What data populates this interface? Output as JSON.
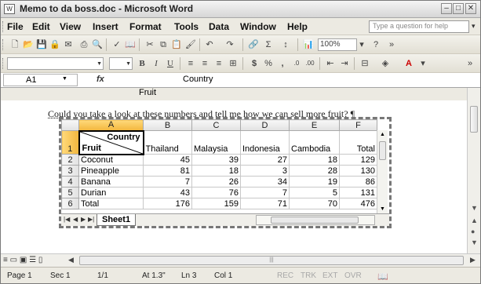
{
  "window": {
    "title": "Memo to da boss.doc - Microsoft Word"
  },
  "menu": {
    "items": [
      "File",
      "Edit",
      "View",
      "Insert",
      "Format",
      "Tools",
      "Data",
      "Window",
      "Help"
    ],
    "help_placeholder": "Type a question for help"
  },
  "toolbar": {
    "zoom": "100%",
    "bold": "B",
    "italic": "I",
    "underline": "U",
    "currency": "$",
    "percent": "%",
    "comma": ","
  },
  "formula_bar": {
    "cell_ref": "A1",
    "fx": "fx",
    "value_line1": "Country",
    "value_line2": "Fruit"
  },
  "document": {
    "text": "Could you take a look at these numbers and tell me how we can sell more fruit?"
  },
  "sheet": {
    "columns": [
      "A",
      "B",
      "C",
      "D",
      "E",
      "F"
    ],
    "header_cell": {
      "top": "Country",
      "bottom": "Fruit"
    },
    "header_row": [
      "Thailand",
      "Malaysia",
      "Indonesia",
      "Cambodia",
      "Total"
    ],
    "rows": [
      {
        "n": "2",
        "label": "Coconut",
        "values": [
          "45",
          "39",
          "27",
          "18",
          "129"
        ]
      },
      {
        "n": "3",
        "label": "Pineapple",
        "values": [
          "81",
          "18",
          "3",
          "28",
          "130"
        ]
      },
      {
        "n": "4",
        "label": "Banana",
        "values": [
          "7",
          "26",
          "34",
          "19",
          "86"
        ]
      },
      {
        "n": "5",
        "label": "Durian",
        "values": [
          "43",
          "76",
          "7",
          "5",
          "131"
        ]
      },
      {
        "n": "6",
        "label": "Total",
        "values": [
          "176",
          "159",
          "71",
          "70",
          "476"
        ]
      }
    ],
    "row1": "1",
    "tab": "Sheet1"
  },
  "status": {
    "page": "Page 1",
    "sec": "Sec 1",
    "pages": "1/1",
    "at": "At 1.3\"",
    "ln": "Ln 3",
    "col": "Col 1",
    "rec": "REC",
    "trk": "TRK",
    "ext": "EXT",
    "ovr": "OVR"
  }
}
